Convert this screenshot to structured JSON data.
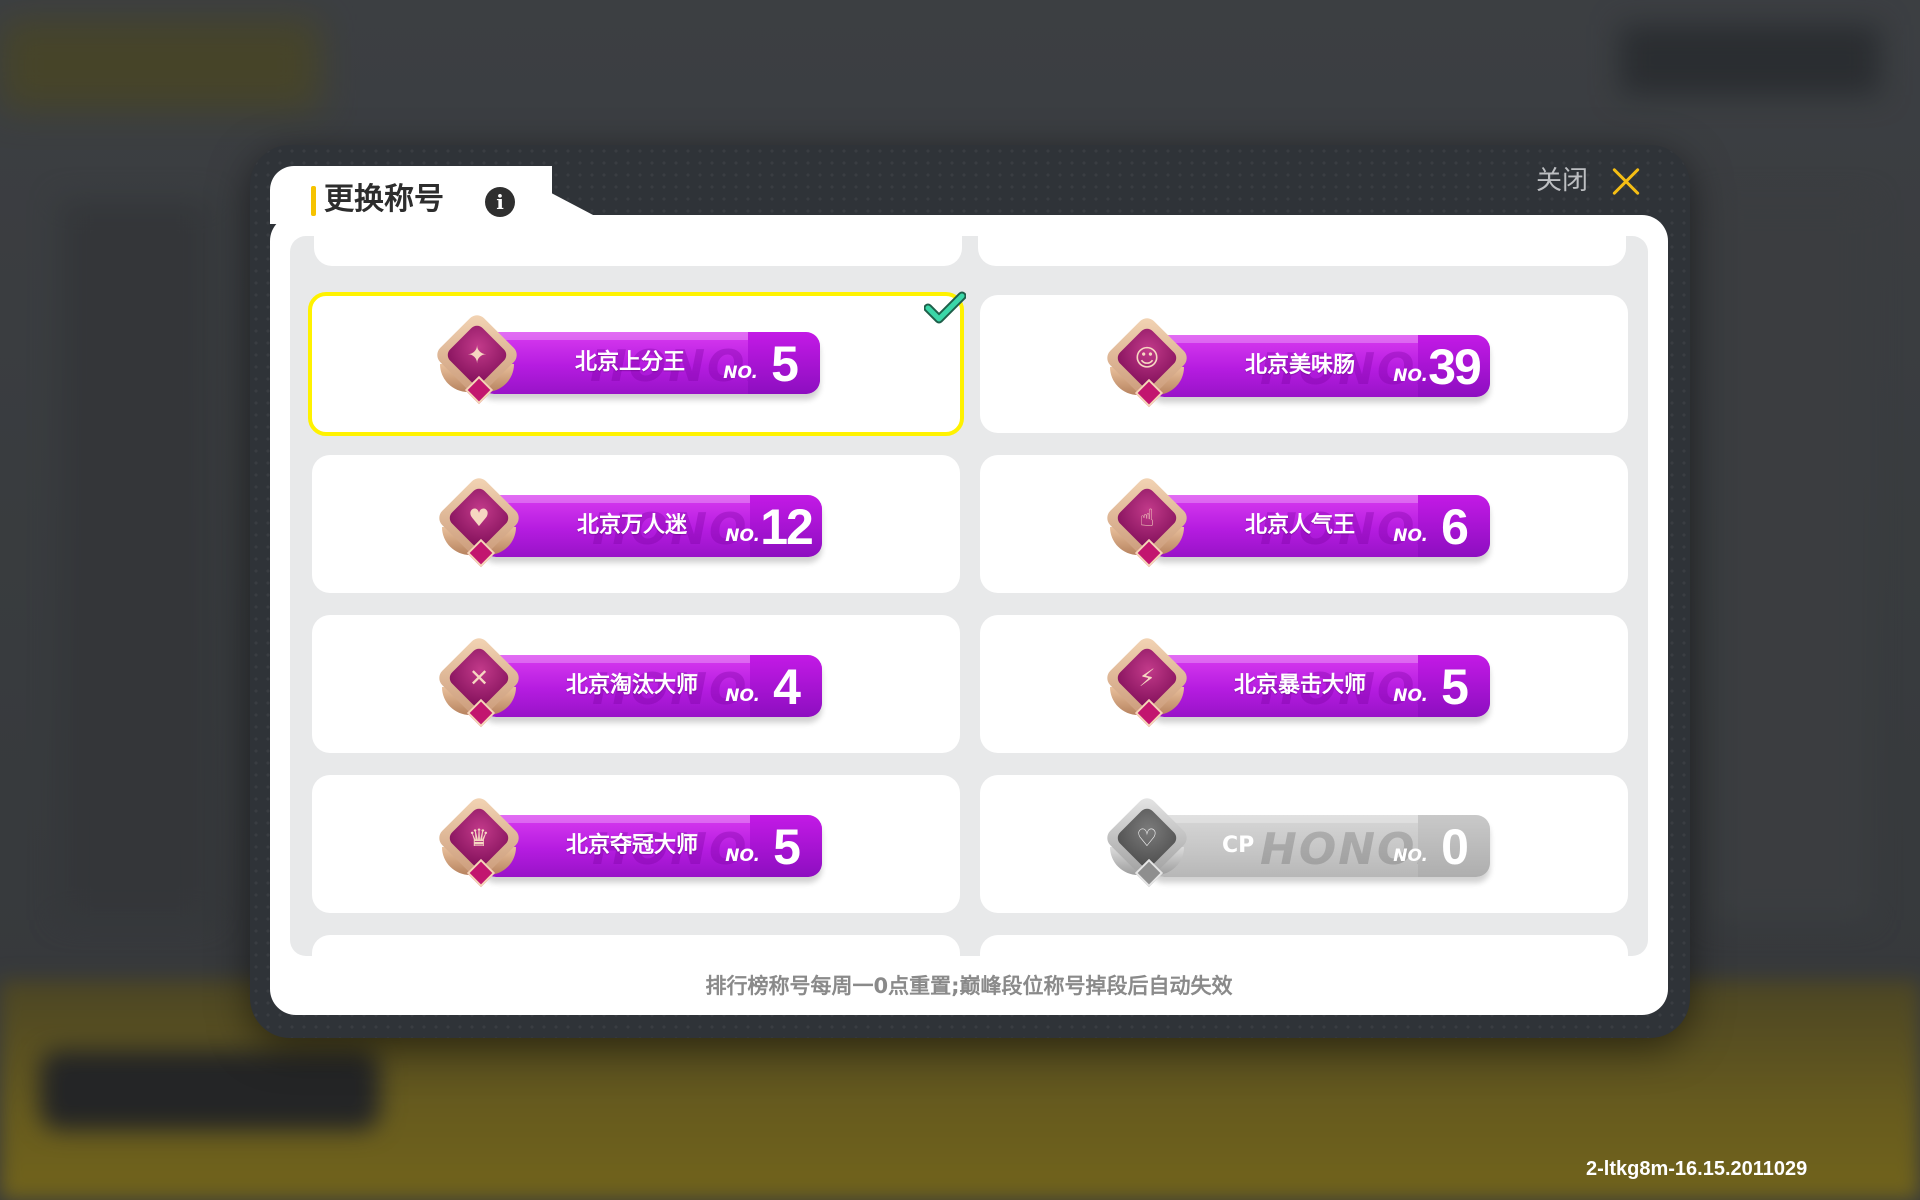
{
  "dialog": {
    "title": "更换称号",
    "close_label": "关闭",
    "footer_note": "排行榜称号每周一0点重置;巅峰段位称号掉段后自动失效"
  },
  "titles": [
    {
      "name": "北京上分王",
      "no_label": "NO.",
      "rank": "5",
      "selected": true,
      "variant": "purple",
      "icon": "star-cluster-icon"
    },
    {
      "name": "北京美味肠",
      "no_label": "NO.",
      "rank": "39",
      "selected": false,
      "variant": "purple",
      "icon": "smiling-face-icon"
    },
    {
      "name": "北京万人迷",
      "no_label": "NO.",
      "rank": "12",
      "selected": false,
      "variant": "purple",
      "icon": "hearts-icon"
    },
    {
      "name": "北京人气王",
      "no_label": "NO.",
      "rank": "6",
      "selected": false,
      "variant": "purple",
      "icon": "thumbs-up-icon"
    },
    {
      "name": "北京淘汰大师",
      "no_label": "NO.",
      "rank": "4",
      "selected": false,
      "variant": "purple",
      "icon": "knockout-face-icon"
    },
    {
      "name": "北京暴击大师",
      "no_label": "NO.",
      "rank": "5",
      "selected": false,
      "variant": "purple",
      "icon": "critical-hit-icon"
    },
    {
      "name": "北京夺冠大师",
      "no_label": "NO.",
      "rank": "5",
      "selected": false,
      "variant": "purple",
      "icon": "trophy-icon"
    },
    {
      "name": "CP",
      "no_label": "NO.",
      "rank": "0",
      "selected": false,
      "variant": "grey",
      "icon": "speech-hearts-icon"
    }
  ],
  "plate_watermark": "HONOR",
  "build_id": "2-ltkg8m-16.15.2011029",
  "colors": {
    "accent_yellow": "#f6c300",
    "selected_border": "#fff200",
    "check_green": "#3ad7a8",
    "plate_purple": "#b51ce0",
    "plate_grey": "#c5c5c5"
  }
}
